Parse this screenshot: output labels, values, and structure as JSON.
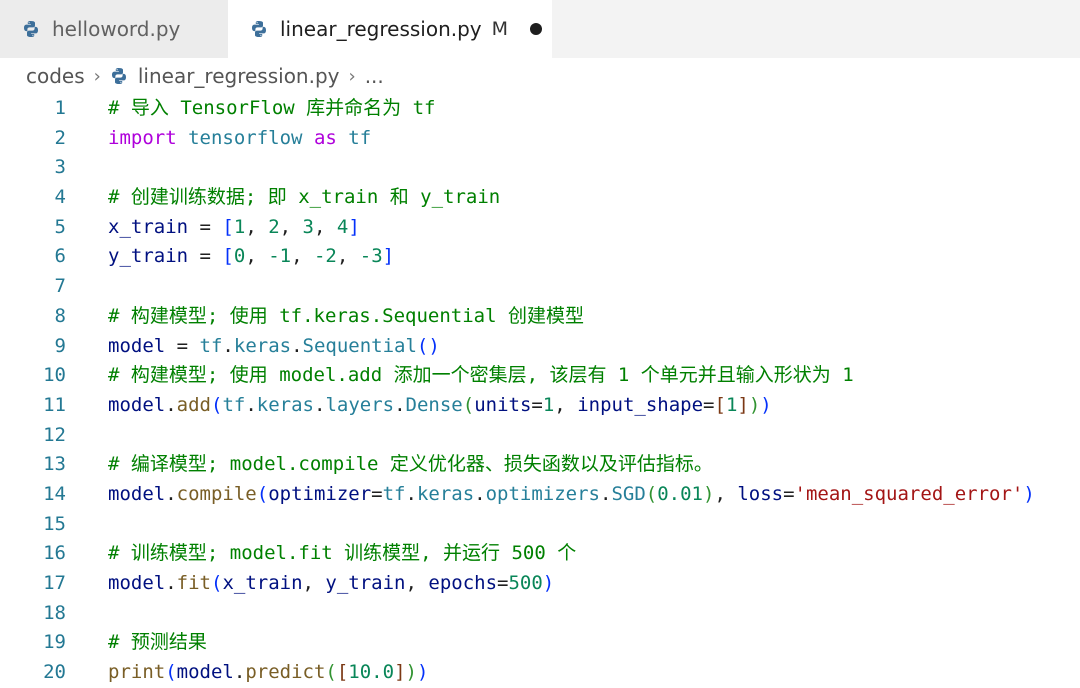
{
  "tabs": [
    {
      "label": "helloword.py",
      "active": false
    },
    {
      "label": "linear_regression.py",
      "active": true,
      "modified": "M"
    }
  ],
  "breadcrumb": {
    "folder": "codes",
    "file": "linear_regression.py",
    "more": "..."
  },
  "editor": {
    "lines": [
      {
        "n": "1",
        "tokens": [
          {
            "t": "# 导入 TensorFlow 库并命名为 tf",
            "c": "comment"
          }
        ]
      },
      {
        "n": "2",
        "tokens": [
          {
            "t": "import",
            "c": "kw-ctrl"
          },
          {
            "t": " ",
            "c": "plain"
          },
          {
            "t": "tensorflow",
            "c": "module"
          },
          {
            "t": " ",
            "c": "plain"
          },
          {
            "t": "as",
            "c": "kw-ctrl"
          },
          {
            "t": " ",
            "c": "plain"
          },
          {
            "t": "tf",
            "c": "module"
          }
        ]
      },
      {
        "n": "3",
        "tokens": []
      },
      {
        "n": "4",
        "tokens": [
          {
            "t": "# 创建训练数据; 即 x_train 和 y_train",
            "c": "comment"
          }
        ]
      },
      {
        "n": "5",
        "tokens": [
          {
            "t": "x_train",
            "c": "var"
          },
          {
            "t": " = ",
            "c": "plain"
          },
          {
            "t": "[",
            "c": "b1"
          },
          {
            "t": "1",
            "c": "num"
          },
          {
            "t": ", ",
            "c": "plain"
          },
          {
            "t": "2",
            "c": "num"
          },
          {
            "t": ", ",
            "c": "plain"
          },
          {
            "t": "3",
            "c": "num"
          },
          {
            "t": ", ",
            "c": "plain"
          },
          {
            "t": "4",
            "c": "num"
          },
          {
            "t": "]",
            "c": "b1"
          }
        ]
      },
      {
        "n": "6",
        "tokens": [
          {
            "t": "y_train",
            "c": "var"
          },
          {
            "t": " = ",
            "c": "plain"
          },
          {
            "t": "[",
            "c": "b1"
          },
          {
            "t": "0",
            "c": "num"
          },
          {
            "t": ", ",
            "c": "plain"
          },
          {
            "t": "-1",
            "c": "num"
          },
          {
            "t": ", ",
            "c": "plain"
          },
          {
            "t": "-2",
            "c": "num"
          },
          {
            "t": ", ",
            "c": "plain"
          },
          {
            "t": "-3",
            "c": "num"
          },
          {
            "t": "]",
            "c": "b1"
          }
        ]
      },
      {
        "n": "7",
        "tokens": []
      },
      {
        "n": "8",
        "tokens": [
          {
            "t": "# 构建模型; 使用 tf.keras.Sequential 创建模型",
            "c": "comment"
          }
        ]
      },
      {
        "n": "9",
        "tokens": [
          {
            "t": "model",
            "c": "var"
          },
          {
            "t": " = ",
            "c": "plain"
          },
          {
            "t": "tf",
            "c": "module"
          },
          {
            "t": ".",
            "c": "plain"
          },
          {
            "t": "keras",
            "c": "module"
          },
          {
            "t": ".",
            "c": "plain"
          },
          {
            "t": "Sequential",
            "c": "module"
          },
          {
            "t": "()",
            "c": "b1"
          }
        ]
      },
      {
        "n": "10",
        "tokens": [
          {
            "t": "# 构建模型; 使用 model.add 添加一个密集层, 该层有 1 个单元并且输入形状为 1",
            "c": "comment"
          }
        ]
      },
      {
        "n": "11",
        "tokens": [
          {
            "t": "model",
            "c": "var"
          },
          {
            "t": ".",
            "c": "plain"
          },
          {
            "t": "add",
            "c": "fn"
          },
          {
            "t": "(",
            "c": "b1"
          },
          {
            "t": "tf",
            "c": "module"
          },
          {
            "t": ".",
            "c": "plain"
          },
          {
            "t": "keras",
            "c": "module"
          },
          {
            "t": ".",
            "c": "plain"
          },
          {
            "t": "layers",
            "c": "module"
          },
          {
            "t": ".",
            "c": "plain"
          },
          {
            "t": "Dense",
            "c": "module"
          },
          {
            "t": "(",
            "c": "b2"
          },
          {
            "t": "units",
            "c": "var"
          },
          {
            "t": "=",
            "c": "plain"
          },
          {
            "t": "1",
            "c": "num"
          },
          {
            "t": ", ",
            "c": "plain"
          },
          {
            "t": "input_shape",
            "c": "var"
          },
          {
            "t": "=",
            "c": "plain"
          },
          {
            "t": "[",
            "c": "b3"
          },
          {
            "t": "1",
            "c": "num"
          },
          {
            "t": "]",
            "c": "b3"
          },
          {
            "t": ")",
            "c": "b2"
          },
          {
            "t": ")",
            "c": "b1"
          }
        ]
      },
      {
        "n": "12",
        "tokens": []
      },
      {
        "n": "13",
        "tokens": [
          {
            "t": "# 编译模型; model.compile 定义优化器、损失函数以及评估指标。",
            "c": "comment"
          }
        ]
      },
      {
        "n": "14",
        "tokens": [
          {
            "t": "model",
            "c": "var"
          },
          {
            "t": ".",
            "c": "plain"
          },
          {
            "t": "compile",
            "c": "fn"
          },
          {
            "t": "(",
            "c": "b1"
          },
          {
            "t": "optimizer",
            "c": "var"
          },
          {
            "t": "=",
            "c": "plain"
          },
          {
            "t": "tf",
            "c": "module"
          },
          {
            "t": ".",
            "c": "plain"
          },
          {
            "t": "keras",
            "c": "module"
          },
          {
            "t": ".",
            "c": "plain"
          },
          {
            "t": "optimizers",
            "c": "module"
          },
          {
            "t": ".",
            "c": "plain"
          },
          {
            "t": "SGD",
            "c": "module"
          },
          {
            "t": "(",
            "c": "b2"
          },
          {
            "t": "0.01",
            "c": "num"
          },
          {
            "t": ")",
            "c": "b2"
          },
          {
            "t": ", ",
            "c": "plain"
          },
          {
            "t": "loss",
            "c": "var"
          },
          {
            "t": "=",
            "c": "plain"
          },
          {
            "t": "'mean_squared_error'",
            "c": "str"
          },
          {
            "t": ")",
            "c": "b1"
          }
        ]
      },
      {
        "n": "15",
        "tokens": []
      },
      {
        "n": "16",
        "tokens": [
          {
            "t": "# 训练模型; model.fit 训练模型, 并运行 500 个",
            "c": "comment"
          }
        ]
      },
      {
        "n": "17",
        "tokens": [
          {
            "t": "model",
            "c": "var"
          },
          {
            "t": ".",
            "c": "plain"
          },
          {
            "t": "fit",
            "c": "fn"
          },
          {
            "t": "(",
            "c": "b1"
          },
          {
            "t": "x_train",
            "c": "var"
          },
          {
            "t": ", ",
            "c": "plain"
          },
          {
            "t": "y_train",
            "c": "var"
          },
          {
            "t": ", ",
            "c": "plain"
          },
          {
            "t": "epochs",
            "c": "var"
          },
          {
            "t": "=",
            "c": "plain"
          },
          {
            "t": "500",
            "c": "num"
          },
          {
            "t": ")",
            "c": "b1"
          }
        ]
      },
      {
        "n": "18",
        "tokens": []
      },
      {
        "n": "19",
        "tokens": [
          {
            "t": "# 预测结果",
            "c": "comment"
          }
        ]
      },
      {
        "n": "20",
        "tokens": [
          {
            "t": "print",
            "c": "fn"
          },
          {
            "t": "(",
            "c": "b1"
          },
          {
            "t": "model",
            "c": "var"
          },
          {
            "t": ".",
            "c": "plain"
          },
          {
            "t": "predict",
            "c": "fn"
          },
          {
            "t": "(",
            "c": "b2"
          },
          {
            "t": "[",
            "c": "b3"
          },
          {
            "t": "10.0",
            "c": "num"
          },
          {
            "t": "]",
            "c": "b3"
          },
          {
            "t": ")",
            "c": "b2"
          },
          {
            "t": ")",
            "c": "b1"
          }
        ]
      }
    ]
  }
}
